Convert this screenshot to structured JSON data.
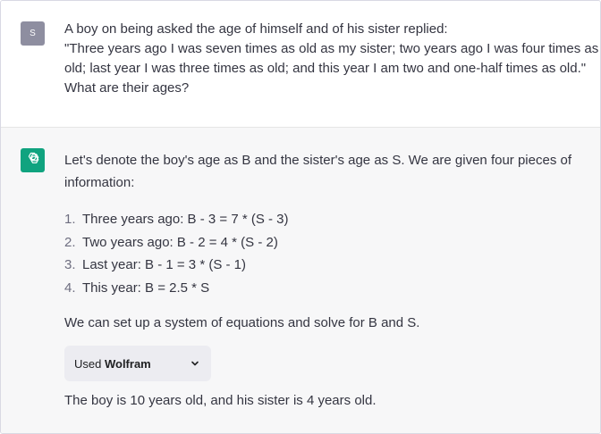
{
  "user": {
    "avatar_initial": "S",
    "lines": [
      "A boy on being asked the age of himself and of his sister replied:",
      "\"Three years ago I was seven times as old as my sister; two years ago I was  four times as",
      "old; last year I was three times as old; and this year I am two and one-half times as old.\"",
      "What are their ages?"
    ]
  },
  "assistant": {
    "intro": "Let's denote the boy's age as B and the sister's age as S. We are given four pieces of information:",
    "steps": [
      {
        "num": "1.",
        "text": "Three years ago: B - 3 = 7 * (S - 3)"
      },
      {
        "num": "2.",
        "text": "Two years ago: B - 2 = 4 * (S - 2)"
      },
      {
        "num": "3.",
        "text": "Last year: B - 1 = 3 * (S - 1)"
      },
      {
        "num": "4.",
        "text": "This year: B = 2.5 * S"
      }
    ],
    "setup": "We can set up a system of equations and solve for B and S.",
    "plugin": {
      "prefix": "Used ",
      "name": "Wolfram"
    },
    "answer": "The boy is 10 years old, and his sister is 4 years old."
  },
  "colors": {
    "brand": "#10a37f",
    "user_avatar": "#8e8ea0",
    "assistant_bg": "#f7f7f8"
  },
  "icons": {
    "assistant_avatar": "openai-logo-icon",
    "plugin_toggle": "chevron-down-icon"
  }
}
